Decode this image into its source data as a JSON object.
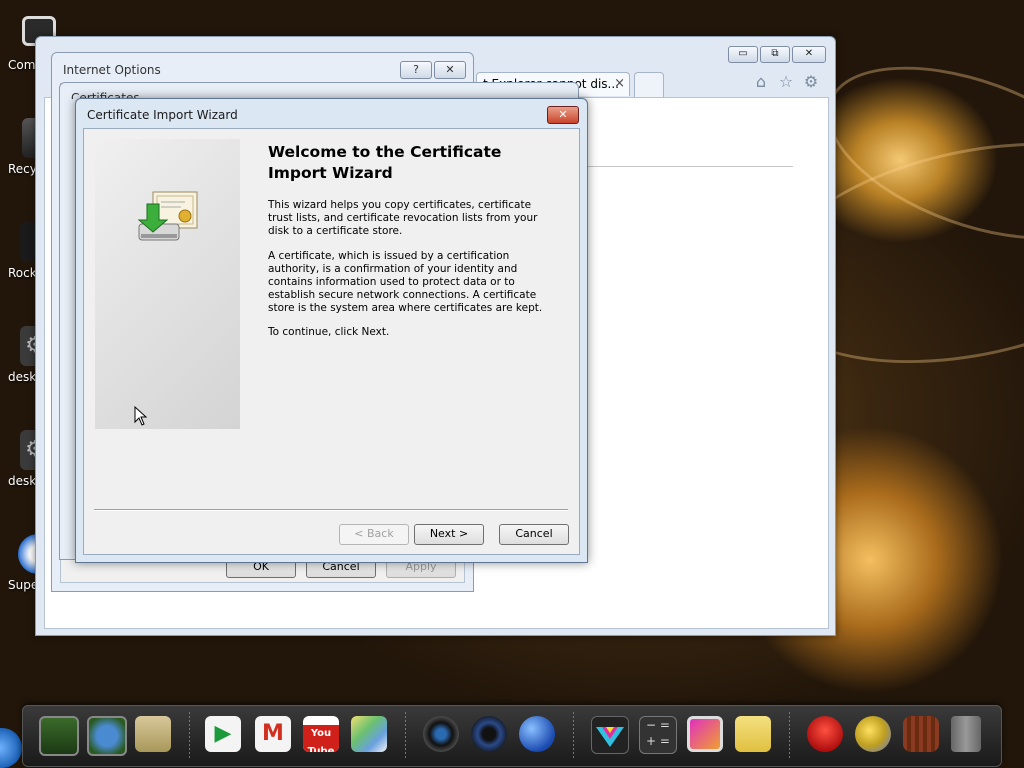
{
  "desktop": {
    "icons": [
      {
        "label": "Com",
        "icon": "computer-icon"
      },
      {
        "label": "Recy",
        "icon": "recycle-bin-icon"
      },
      {
        "label": "Rocke",
        "icon": "rocketdock-icon"
      },
      {
        "label": "desk",
        "icon": "desktop-gear-icon"
      },
      {
        "label": "desk",
        "icon": "desktop-gear-icon"
      },
      {
        "label": "Supe",
        "icon": "super-app-icon"
      }
    ]
  },
  "browser": {
    "tab_label": "t Explorer cannot dis...",
    "tab_close": "×",
    "caption": {
      "minimize": "▭",
      "restore": "⧉",
      "close": "✕"
    },
    "toolbar_icons": [
      "home-icon",
      "star-icon",
      "gear-icon"
    ]
  },
  "internet_options": {
    "title": "Internet Options",
    "help_button": "?",
    "close_button": "✕",
    "buttons": {
      "ok": "OK",
      "cancel": "Cancel",
      "apply": "Apply"
    }
  },
  "certificates_dialog": {
    "title": "Certificates"
  },
  "wizard": {
    "title": "Certificate Import Wizard",
    "close_button": "✕",
    "heading": "Welcome to the Certificate Import Wizard",
    "paragraph1": "This wizard helps you copy certificates, certificate trust lists, and certificate revocation lists from your disk to a certificate store.",
    "paragraph2": "A certificate, which is issued by a certification authority, is a confirmation of your identity and contains information used to protect data or to establish secure network connections. A certificate store is the system area where certificates are kept.",
    "paragraph3": "To continue, click Next.",
    "buttons": {
      "back": "< Back",
      "next": "Next >",
      "cancel": "Cancel"
    }
  },
  "dock": {
    "icons": [
      "android-screen-icon",
      "android-globe-icon",
      "android-folder-icon",
      "play-store-icon",
      "gmail-icon",
      "youtube-icon",
      "maps-icon",
      "camera-lens-icon",
      "speaker-icon",
      "firefox-globe-icon",
      "color-triangle-icon",
      "calculator-icon",
      "gallery-icon",
      "notes-icon",
      "angry-birds-icon",
      "weather-icon",
      "recycle-bin-icon",
      "trash-can-icon"
    ],
    "youtube_text": "You Tube"
  }
}
